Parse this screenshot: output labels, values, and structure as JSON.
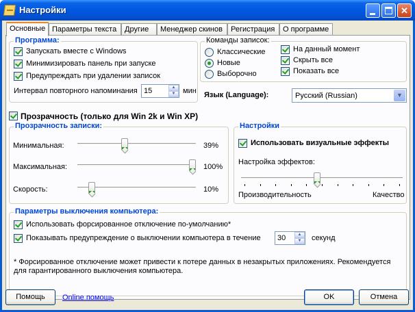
{
  "window": {
    "title": "Настройки"
  },
  "tabs": [
    "Основные",
    "Параметры текста",
    "Другие",
    "Менеджер скинов",
    "Регистрация",
    "О программе"
  ],
  "program": {
    "title": "Программа:",
    "items": [
      {
        "label": "Запускать вместе с Windows",
        "checked": true
      },
      {
        "label": "Минимизировать панель при запуске",
        "checked": true
      },
      {
        "label": "Предупреждать при удалении записок",
        "checked": true
      }
    ],
    "reminder_label": "Интервал повторного напоминания",
    "reminder_value": "15",
    "reminder_unit": "мин"
  },
  "note_commands": {
    "title": "Команды записок:",
    "radios": [
      {
        "label": "Классические",
        "selected": false
      },
      {
        "label": "Новые",
        "selected": true
      },
      {
        "label": "Выборочно",
        "selected": false
      }
    ],
    "checks": [
      {
        "label": "На данный момент",
        "checked": true
      },
      {
        "label": "Скрыть все",
        "checked": true
      },
      {
        "label": "Показать все",
        "checked": true
      }
    ]
  },
  "language": {
    "label": "Язык (Language):",
    "value": "Русский (Russian)"
  },
  "transparency": {
    "checkbox_label": "Прозрачность (только для Win 2k и Win XP)",
    "checked": true,
    "title": "Прозрачность записки:",
    "sliders": [
      {
        "label": "Минимальная:",
        "value_text": "39%",
        "fraction": 0.39
      },
      {
        "label": "Максимальная:",
        "value_text": "100%",
        "fraction": 1.0
      },
      {
        "label": "Скорость:",
        "value_text": "10%",
        "fraction": 0.1
      }
    ]
  },
  "settings": {
    "title": "Настройки",
    "visual_label": "Использовать визуальные эффекты",
    "visual_checked": true,
    "effects_label": "Настройка эффектов:",
    "effects_fraction": 0.47,
    "left_label": "Производительность",
    "right_label": "Качество"
  },
  "shutdown": {
    "title": "Параметры выключения компьютера:",
    "force_label": "Использовать форсированное отключение по-умолчанию*",
    "force_checked": true,
    "warn_label": "Показывать предупреждение о выключении компьютера в течение",
    "warn_checked": true,
    "warn_value": "30",
    "warn_unit": "секунд",
    "footnote": "* Форсированное отключение может привести к потере данных в незакрытых приложениях. Рекомендуется для гарантированного выключения компьютера."
  },
  "buttons": {
    "help": "Помощь",
    "online_help": "Online помощь",
    "ok": "OK",
    "cancel": "Отмена"
  },
  "colors": {
    "group_title": "#0046d5",
    "check": "#21a121",
    "titlebar": "#0058e3"
  }
}
